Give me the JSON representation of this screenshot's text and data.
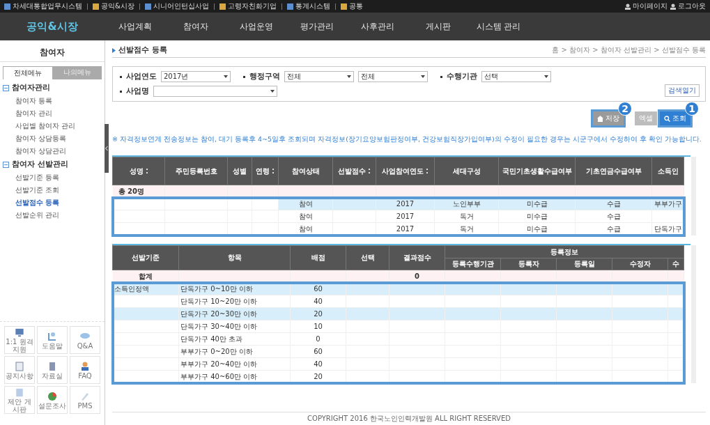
{
  "top_links": [
    {
      "label": "차세대통합업무시스템"
    },
    {
      "label": "공익&시장"
    },
    {
      "label": "시니어인턴십사업"
    },
    {
      "label": "고령자친화기업"
    },
    {
      "label": "통계시스템"
    },
    {
      "label": "공통"
    }
  ],
  "account_links": [
    {
      "label": "마이페이지"
    },
    {
      "label": "로그아웃"
    }
  ],
  "nav": [
    {
      "label": "공익&시장",
      "selected": true
    },
    {
      "label": "사업계획",
      "selected": false
    },
    {
      "label": "참여자",
      "selected": false
    },
    {
      "label": "사업운영",
      "selected": false
    },
    {
      "label": "평가관리",
      "selected": false
    },
    {
      "label": "사후관리",
      "selected": false
    },
    {
      "label": "게시판",
      "selected": false
    },
    {
      "label": "시스템 관리",
      "selected": false
    }
  ],
  "sidebar": {
    "title": "참여자",
    "tabs": [
      {
        "label": "전체메뉴",
        "selected": true
      },
      {
        "label": "나의메뉴",
        "selected": false
      }
    ],
    "groups": [
      {
        "label": "참여자관리",
        "expanded": true,
        "children": [
          {
            "label": "참여자 등록",
            "selected": false
          },
          {
            "label": "참여자 관리",
            "selected": false
          },
          {
            "label": "사업별 참여자 관리",
            "selected": false
          },
          {
            "label": "참여자 상담등록",
            "selected": false
          },
          {
            "label": "참여자 상담관리",
            "selected": false
          }
        ]
      },
      {
        "label": "참여자 선발관리",
        "expanded": true,
        "children": [
          {
            "label": "선발기준 등록",
            "selected": false
          },
          {
            "label": "선발기준 조회",
            "selected": false
          },
          {
            "label": "선발점수 등록",
            "selected": true
          },
          {
            "label": "선발순위 관리",
            "selected": false
          }
        ]
      }
    ],
    "shortcuts": [
      {
        "label": "1:1 원격지원",
        "kind": "monitor"
      },
      {
        "label": "도움말",
        "kind": "help"
      },
      {
        "label": "Q&A",
        "kind": "chat"
      },
      {
        "label": "공지사항",
        "kind": "note"
      },
      {
        "label": "자료실",
        "kind": "book"
      },
      {
        "label": "FAQ",
        "kind": "person"
      },
      {
        "label": "제안 게시판",
        "kind": "board"
      },
      {
        "label": "설문조사",
        "kind": "pie"
      },
      {
        "label": "PMS",
        "kind": "pen"
      }
    ]
  },
  "page": {
    "title": "선발점수 등록",
    "breadcrumb": "홈 > 참여자 > 참여자 선발관리 > 선발점수 등록"
  },
  "filters": [
    {
      "label": "사업연도",
      "fields": [
        {
          "value": "2017년"
        }
      ]
    },
    {
      "label": "행정구역",
      "fields": [
        {
          "value": "전체"
        },
        {
          "value": "전체"
        }
      ]
    },
    {
      "label": "수행기관",
      "fields": [
        {
          "value": "선택"
        }
      ]
    },
    {
      "label": "사업명",
      "fields": [
        {
          "kind": "blank"
        }
      ]
    }
  ],
  "search_toggle": "검색열기",
  "actions": [
    {
      "label": "저장",
      "kind": "save",
      "callout": "2"
    },
    {
      "label": "엑셀",
      "kind": "plain"
    },
    {
      "label": "조회",
      "kind": "search",
      "callout": "1"
    }
  ],
  "notice": "※ 자격정보연계 전송정보는 참여, 대기 등록후 4~5일후 조회되며 자격정보(장기요양보험판정여부, 건강보험직장가입여부)의 수정이 필요한 경우는 시군구에서 수정하여 후 확인 가능합니다.",
  "participants": {
    "columns": [
      {
        "label": "성명",
        "sortable": true
      },
      {
        "label": "주민등록번호",
        "sortable": false
      },
      {
        "label": "성별",
        "sortable": false
      },
      {
        "label": "연령",
        "sortable": true
      },
      {
        "label": "참여상태",
        "sortable": false
      },
      {
        "label": "선발점수",
        "sortable": true
      },
      {
        "label": "사업참여연도",
        "sortable": true
      },
      {
        "label": "세대구성",
        "sortable": false
      },
      {
        "label": "국민기초생활수급여부",
        "sortable": false
      },
      {
        "label": "기초연금수급여부",
        "sortable": false
      },
      {
        "label": "소득인",
        "sortable": false
      }
    ],
    "total": "총 20명",
    "rows": [
      {
        "selected": true,
        "cells": {
          "4": "참여",
          "6": "2017",
          "7": "노인부부",
          "8": "미수급",
          "9": "수급",
          "10": "부부가구"
        }
      },
      {
        "selected": false,
        "cells": {
          "4": "참여",
          "6": "2017",
          "7": "독거",
          "8": "미수급",
          "9": "수급"
        }
      },
      {
        "selected": false,
        "cells": {
          "4": "참여",
          "6": "2017",
          "7": "독거",
          "8": "미수급",
          "9": "수급",
          "10": "단독가구"
        }
      }
    ]
  },
  "scores": {
    "columns": [
      {
        "label": "선발기준"
      },
      {
        "label": "항목"
      },
      {
        "label": "배점"
      },
      {
        "label": "선택"
      },
      {
        "label": "결과점수"
      }
    ],
    "group_label": "등록정보",
    "group_columns": [
      {
        "label": "등록수행기관"
      },
      {
        "label": "등록자"
      },
      {
        "label": "등록일"
      },
      {
        "label": "수정자"
      },
      {
        "label": "수"
      }
    ],
    "total_label": "합계",
    "total_score": "0",
    "rows": [
      {
        "criterion": "소득인정액",
        "item": "단독가구 0~10만 이하",
        "points": "60",
        "selected": true
      },
      {
        "item": "단독가구 10~20만 이하",
        "points": "40",
        "selected": false
      },
      {
        "item": "단독가구 20~30만 이하",
        "points": "20",
        "selected": true
      },
      {
        "item": "단독가구 30~40만 이하",
        "points": "10",
        "selected": false
      },
      {
        "item": "단독가구 40만 초과",
        "points": "0",
        "selected": false
      },
      {
        "item": "부부가구 0~20만 이하",
        "points": "60",
        "selected": false
      },
      {
        "item": "부부가구 20~40만 이하",
        "points": "40",
        "selected": false
      },
      {
        "item": "부부가구 40~60만 이하",
        "points": "20",
        "selected": false
      }
    ]
  },
  "footer": "COPYRIGHT 2016 한국노인인력개발원 ALL RIGHT RESERVED"
}
